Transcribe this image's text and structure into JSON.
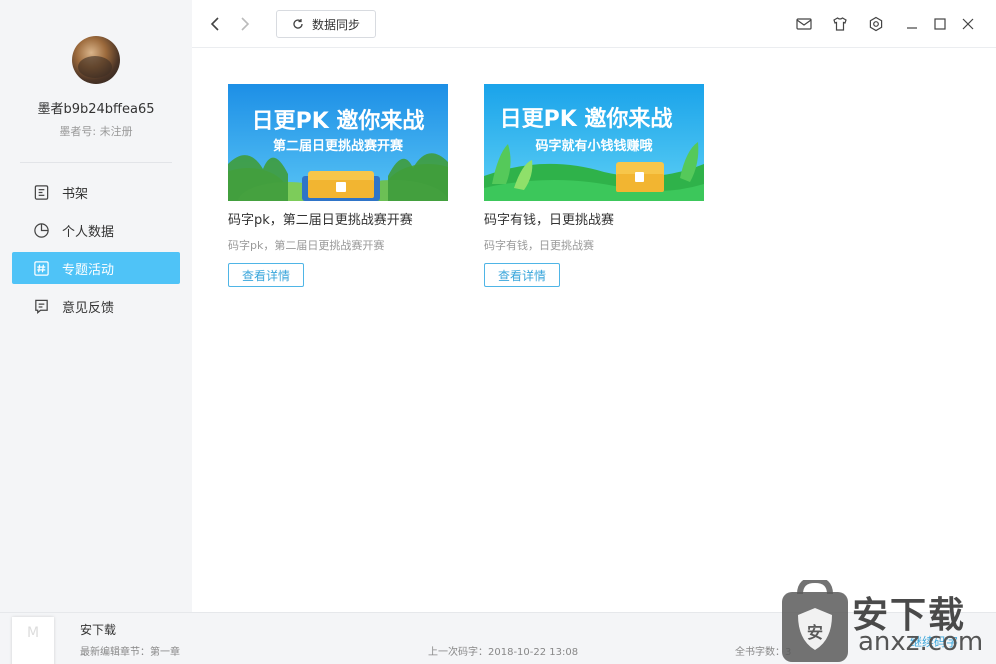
{
  "user": {
    "name": "墨者b9b24bffea65",
    "id_text": "墨者号: 未注册"
  },
  "nav": [
    {
      "label": "书架",
      "icon": "bookshelf-icon"
    },
    {
      "label": "个人数据",
      "icon": "pie-chart-icon"
    },
    {
      "label": "专题活动",
      "icon": "hashtag-icon",
      "active": true
    },
    {
      "label": "意见反馈",
      "icon": "feedback-icon"
    }
  ],
  "toolbar": {
    "sync_label": "数据同步"
  },
  "cards": [
    {
      "banner_title": "日更PK 邀你来战",
      "banner_sub": "第二届日更挑战赛开赛",
      "title": "码字pk，第二届日更挑战赛开赛",
      "desc": "码字pk，第二届日更挑战赛开赛",
      "button": "查看详情"
    },
    {
      "banner_title": "日更PK 邀你来战",
      "banner_sub": "码字就有小钱钱赚哦",
      "title": "码字有钱，日更挑战赛",
      "desc": "码字有钱，日更挑战赛",
      "button": "查看详情"
    }
  ],
  "footer": {
    "thumb_text": "M",
    "book_name": "安下载",
    "chapter": "最新编辑章节：第一章",
    "last_edit": "上一次码字：2018-10-22 13:08",
    "total_words": "全书字数：3",
    "continue": "继续码字"
  },
  "watermark": {
    "text": "安下载",
    "sub": "anxz.com"
  },
  "colors": {
    "accent": "#4fc3f7",
    "link": "#3aa6db",
    "sidebar_bg": "#f4f5f7"
  }
}
